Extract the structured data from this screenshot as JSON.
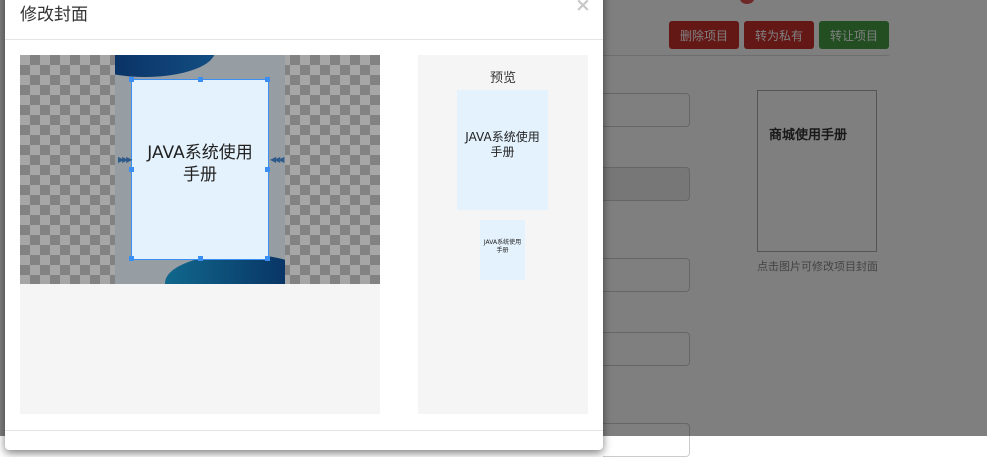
{
  "modal": {
    "title": "修改封面",
    "close_label": "×",
    "crop": {
      "overlay_text_line1": "JAVA系统使用",
      "overlay_text_line2": "手册"
    },
    "preview": {
      "title": "预览",
      "large_text_line1": "JAVA系统使用",
      "large_text_line2": "手册",
      "small_text_line1": "JAVA系统使用",
      "small_text_line2": "手册"
    }
  },
  "background_page": {
    "actions": {
      "delete_label": "删除项目",
      "private_label": "转为私有",
      "transfer_label": "转让项目"
    },
    "cover": {
      "title": "商城使用手册",
      "hint": "点击图片可修改项目封面"
    }
  },
  "colors": {
    "danger": "#c9302c",
    "success": "#449d44",
    "crop_border": "#3b8ef2",
    "cover_bg": "#e4f2fd"
  }
}
